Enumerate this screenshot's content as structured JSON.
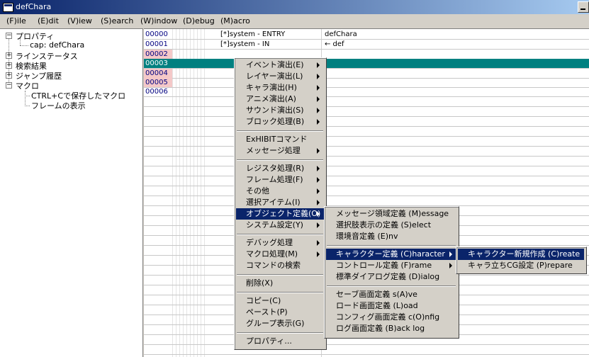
{
  "window": {
    "title": "defChara"
  },
  "menubar": [
    "(F)ile",
    "(E)dit",
    "(V)iew",
    "(S)earch",
    "(W)indow",
    "(D)ebug",
    "(M)acro"
  ],
  "tree": {
    "properties": "プロパティ",
    "cap": "cap: defChara",
    "line_status": "ラインステータス",
    "search_results": "検索結果",
    "jump_history": "ジャンプ履歴",
    "macro": "マクロ",
    "macro_saved": "CTRL+Cで保存したマクロ",
    "show_frames": "フレームの表示"
  },
  "rows": [
    {
      "ln": "00000",
      "mark": "[*]",
      "cmd": "system -  ENTRY",
      "arg": "defChara",
      "bg": "#ffffff"
    },
    {
      "ln": "00001",
      "mark": "[*]",
      "cmd": "system -  IN",
      "arg": "← def",
      "bg": "#ffffff"
    },
    {
      "ln": "00002",
      "mark": "",
      "cmd": "",
      "arg": "",
      "bg": "#f4c8c8"
    },
    {
      "ln": "00003",
      "mark": "",
      "cmd": "",
      "arg": "",
      "bg": "#008080"
    },
    {
      "ln": "00004",
      "mark": "",
      "cmd": "",
      "arg": "",
      "bg": "#f4c8c8"
    },
    {
      "ln": "00005",
      "mark": "",
      "cmd": "",
      "arg": "",
      "bg": "#f4c8c8"
    },
    {
      "ln": "00006",
      "mark": "",
      "cmd": "",
      "arg": "",
      "bg": "#ffffff"
    }
  ],
  "context_menu": {
    "event": "イベント演出(E)",
    "layer": "レイヤー演出(L)",
    "chara": "キャラ演出(H)",
    "anime": "アニメ演出(A)",
    "sound": "サウンド演出(S)",
    "block": "ブロック処理(B)",
    "exhibit": "ExHIBITコマンド",
    "message": "メッセージ処理",
    "register": "レジスタ処理(R)",
    "frame": "フレーム処理(F)",
    "other": "その他",
    "select_item": "選択アイテム(I)",
    "object_def": "オブジェクト定義(O)",
    "system_set": "システム設定(Y)",
    "debug": "デバッグ処理",
    "macro": "マクロ処理(M)",
    "cmd_search": "コマンドの検索",
    "delete": "削除(X)",
    "copy": "コピー(C)",
    "paste": "ペースト(P)",
    "group": "グループ表示(G)",
    "property": "プロパティ..."
  },
  "object_submenu": {
    "msg_area": "メッセージ領域定義 (M)essage",
    "select_def": "選択肢表示の定義 (S)elect",
    "env_sound": "環境音定義 (E)nv",
    "char_def": "キャラクター定義 (C)haracter",
    "control": "コントロール定義 (F)rame",
    "dialog": "標準ダイアログ定義 (D)ialog",
    "save_screen": "セーブ画面定義 s(A)ve",
    "load_screen": "ロード画面定義 (L)oad",
    "config_screen": "コンフィグ画面定義 c(O)nfig",
    "log_screen": "ログ画面定義 (B)ack log"
  },
  "character_submenu": {
    "create": "キャラクター新規作成 (C)reate",
    "prepare": "キャラ立ちCG設定 (P)repare"
  },
  "colors": {
    "selection": "#0a246a",
    "highlight_row": "#008080",
    "marked_row": "#f4c8c8",
    "title_start": "#0a246a",
    "title_end": "#a6caf0"
  }
}
